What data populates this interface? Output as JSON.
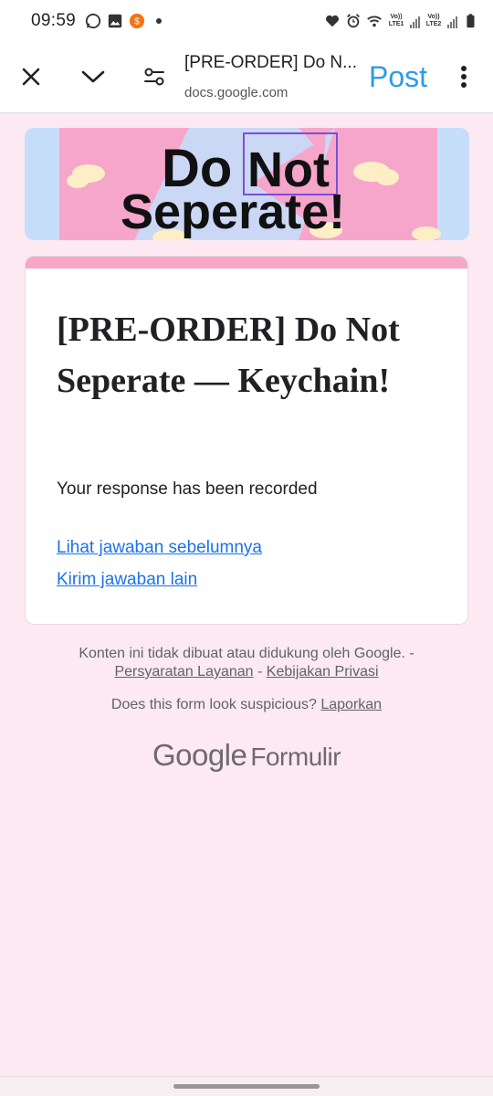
{
  "status_bar": {
    "time": "09:59",
    "sim1_label": "Vo)) LTE1",
    "sim2_label": "Vo)) LTE2"
  },
  "toolbar": {
    "page_title": "[PRE-ORDER] Do N...",
    "url": "docs.google.com",
    "post_label": "Post",
    "icons": [
      "close-icon",
      "chevron-down-icon",
      "page-settings-icon",
      "more-vert-icon"
    ]
  },
  "banner": {
    "line1_word1": "Do",
    "line1_word2": "Not",
    "line2": "Seperate!"
  },
  "form": {
    "title": "[PRE-ORDER] Do Not Seperate — Keychain!",
    "confirmation": "Your response has been recorded",
    "link_previous": "Lihat jawaban sebelumnya",
    "link_another": "Kirim jawaban lain"
  },
  "footer": {
    "disclaimer": "Konten ini tidak dibuat atau didukung oleh Google. -",
    "terms": "Persyaratan Layanan",
    "sep": " - ",
    "privacy": "Kebijakan Privasi",
    "suspicious": "Does this form look suspicious?",
    "report": "Laporkan",
    "logo_google": "Google",
    "logo_product": "Formulir"
  },
  "colors": {
    "page_bg": "#fde9f1",
    "accent_pink": "#f7a7c8",
    "link_blue": "#1a73e8",
    "post_blue": "#2d9be8"
  }
}
